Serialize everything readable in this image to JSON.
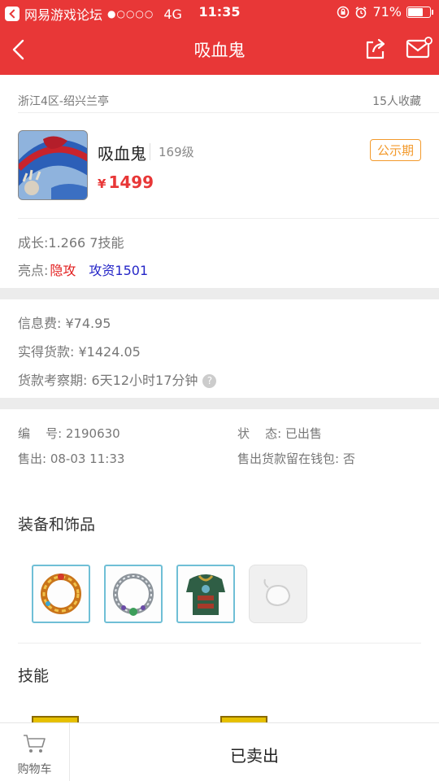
{
  "status_bar": {
    "app": "网易游戏论坛",
    "signal": "●○○○○",
    "network": "4G",
    "time": "11:35",
    "battery": "71%",
    "battery_level": 0.71
  },
  "header": {
    "title": "吸血鬼"
  },
  "listing": {
    "server": "浙江4区-绍兴兰亭",
    "favorites": "15人收藏",
    "pet_name": "吸血鬼",
    "level": "169级",
    "price_symbol": "¥",
    "price": "1499",
    "badge": "公示期",
    "growth": "成长:1.266 7技能",
    "highlights_label": "亮点:",
    "highlight_1": "隐攻",
    "highlight_2": "攻资1501"
  },
  "fees": {
    "info_fee": "信息费: ¥74.95",
    "actual_payment": "实得货款: ¥1424.05",
    "review_period": "货款考察期: 6天12小时17分钟"
  },
  "meta": {
    "number": "编    号: 2190630",
    "status": "状    态: 已出售",
    "sold_at": "售出: 08-03 11:33",
    "wallet": "售出货款留在钱包: 否"
  },
  "sections": {
    "equipment": "装备和饰品",
    "skills": "技能"
  },
  "equipment": [
    {
      "name": "gold-ring-icon",
      "color": "#d98a1a"
    },
    {
      "name": "silver-necklace-icon",
      "color": "#9aa0a6"
    },
    {
      "name": "armor-icon",
      "color": "#3e6e4c"
    },
    {
      "name": "empty-slot-icon",
      "color": "#cccccc"
    }
  ],
  "footer": {
    "cart": "购物车",
    "sold": "已卖出"
  },
  "colors": {
    "brand_red": "#e83737",
    "badge_orange": "#f39a2c",
    "highlight_red": "#e21e1e",
    "highlight_blue": "#2526c7"
  }
}
